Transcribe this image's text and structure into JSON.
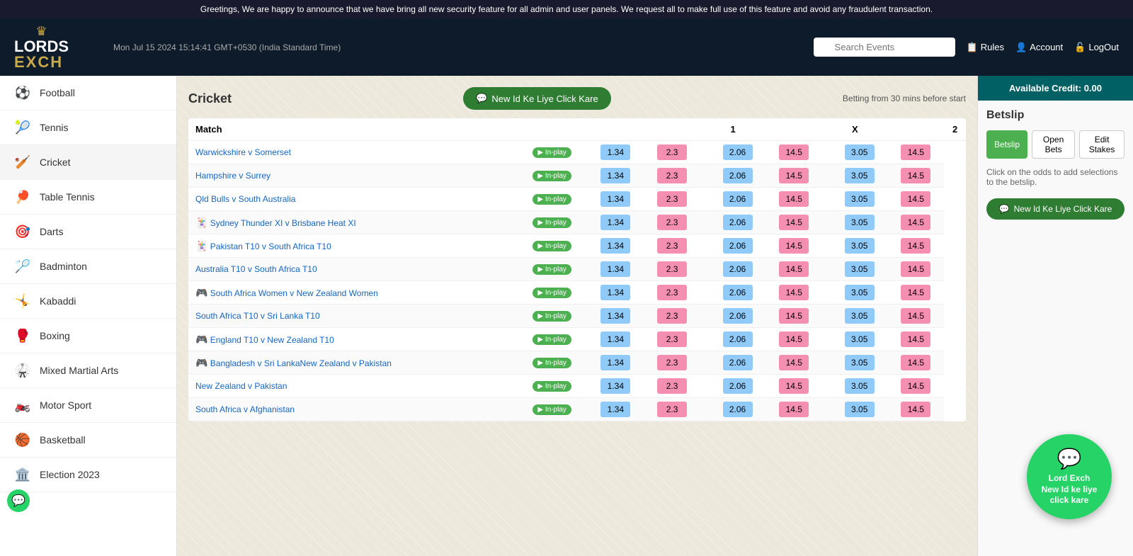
{
  "announcement": {
    "text": "Greetings, We are happy to announce that we have bring all new security feature for all admin and user panels. We request all to make full use of this feature and avoid any fraudulent transaction."
  },
  "header": {
    "logo_lords": "LORDS",
    "logo_exch": "EXCH",
    "datetime": "Mon Jul 15 2024 15:14:41 GMT+0530 (India Standard Time)",
    "search_placeholder": "Search Events",
    "rules_label": "Rules",
    "account_label": "Account",
    "logout_label": "LogOut"
  },
  "sidebar": {
    "items": [
      {
        "label": "Football",
        "icon": "⚽"
      },
      {
        "label": "Tennis",
        "icon": "🎾"
      },
      {
        "label": "Cricket",
        "icon": "🏏"
      },
      {
        "label": "Table Tennis",
        "icon": "🏓"
      },
      {
        "label": "Darts",
        "icon": "🎯"
      },
      {
        "label": "Badminton",
        "icon": "🏸"
      },
      {
        "label": "Kabaddi",
        "icon": "🤸"
      },
      {
        "label": "Boxing",
        "icon": "🥊"
      },
      {
        "label": "Mixed Martial Arts",
        "icon": "🥋"
      },
      {
        "label": "Motor Sport",
        "icon": "🏍️"
      },
      {
        "label": "Basketball",
        "icon": "🏀"
      },
      {
        "label": "Election 2023",
        "icon": "🏛️"
      }
    ]
  },
  "cricket": {
    "title": "Cricket",
    "new_id_btn": "New Id Ke Liye Click Kare",
    "betting_info": "Betting from 30 mins before start",
    "col_1": "1",
    "col_x": "X",
    "col_2": "2",
    "col_match": "Match",
    "matches": [
      {
        "name": "Warwickshire v Somerset",
        "inplay": true,
        "icon": "",
        "b1": "1.34",
        "l1": "2.3",
        "bx": "2.06",
        "lx": "14.5",
        "b2": "3.05",
        "l2": "14.5"
      },
      {
        "name": "Hampshire v Surrey",
        "inplay": true,
        "icon": "",
        "b1": "1.34",
        "l1": "2.3",
        "bx": "2.06",
        "lx": "14.5",
        "b2": "3.05",
        "l2": "14.5"
      },
      {
        "name": "Qld Bulls v South Australia",
        "inplay": true,
        "icon": "",
        "b1": "1.34",
        "l1": "2.3",
        "bx": "2.06",
        "lx": "14.5",
        "b2": "3.05",
        "l2": "14.5"
      },
      {
        "name": "Sydney Thunder XI v Brisbane Heat XI",
        "inplay": true,
        "icon": "🃏",
        "b1": "1.34",
        "l1": "2.3",
        "bx": "2.06",
        "lx": "14.5",
        "b2": "3.05",
        "l2": "14.5"
      },
      {
        "name": "Pakistan T10 v South Africa T10",
        "inplay": true,
        "icon": "🃏",
        "b1": "1.34",
        "l1": "2.3",
        "bx": "2.06",
        "lx": "14.5",
        "b2": "3.05",
        "l2": "14.5"
      },
      {
        "name": "Australia T10 v South Africa T10",
        "inplay": true,
        "icon": "",
        "b1": "1.34",
        "l1": "2.3",
        "bx": "2.06",
        "lx": "14.5",
        "b2": "3.05",
        "l2": "14.5"
      },
      {
        "name": "South Africa Women v New Zealand Women",
        "inplay": true,
        "icon": "🎮",
        "b1": "1.34",
        "l1": "2.3",
        "bx": "2.06",
        "lx": "14.5",
        "b2": "3.05",
        "l2": "14.5"
      },
      {
        "name": "South Africa T10 v Sri Lanka T10",
        "inplay": true,
        "icon": "",
        "b1": "1.34",
        "l1": "2.3",
        "bx": "2.06",
        "lx": "14.5",
        "b2": "3.05",
        "l2": "14.5"
      },
      {
        "name": "England T10 v New Zealand T10",
        "inplay": true,
        "icon": "🎮",
        "b1": "1.34",
        "l1": "2.3",
        "bx": "2.06",
        "lx": "14.5",
        "b2": "3.05",
        "l2": "14.5"
      },
      {
        "name": "Bangladesh v Sri LankaNew Zealand v Pakistan",
        "inplay": true,
        "icon": "🎮",
        "b1": "1.34",
        "l1": "2.3",
        "bx": "2.06",
        "lx": "14.5",
        "b2": "3.05",
        "l2": "14.5"
      },
      {
        "name": "New Zealand v Pakistan",
        "inplay": true,
        "icon": "",
        "b1": "1.34",
        "l1": "2.3",
        "bx": "2.06",
        "lx": "14.5",
        "b2": "3.05",
        "l2": "14.5"
      },
      {
        "name": "South Africa v Afghanistan",
        "inplay": true,
        "icon": "",
        "b1": "1.34",
        "l1": "2.3",
        "bx": "2.06",
        "lx": "14.5",
        "b2": "3.05",
        "l2": "14.5"
      }
    ]
  },
  "betslip": {
    "available_credit_label": "Available Credit:",
    "available_credit_value": "0.00",
    "title": "Betslip",
    "tab_betslip": "Betslip",
    "tab_open_bets": "Open Bets",
    "tab_edit_stakes": "Edit Stakes",
    "hint": "Click on the odds to add selections to the betslip.",
    "new_id_btn": "New Id Ke Liye Click Kare"
  },
  "whatsapp_float": {
    "text": "Lord Exch\nNew Id ke liye\nclick kare"
  }
}
